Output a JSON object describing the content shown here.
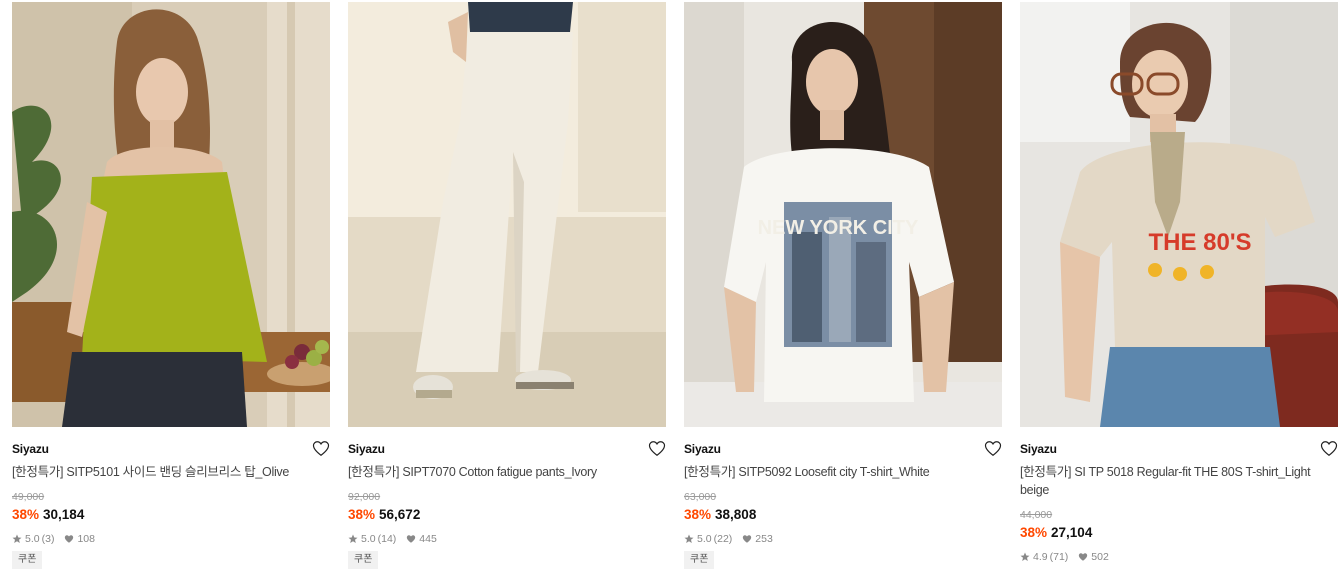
{
  "products": [
    {
      "brand": "Siyazu",
      "name": "[한정특가] SITP5101 사이드 밴딩 슬리브리스 탑_Olive",
      "original_price": "49,000",
      "discount": "38%",
      "price": "30,184",
      "rating": "5.0",
      "reviews": "(3)",
      "likes": "108",
      "badge": "쿠폰"
    },
    {
      "brand": "Siyazu",
      "name": "[한정특가] SIPT7070 Cotton fatigue pants_Ivory",
      "original_price": "92,000",
      "discount": "38%",
      "price": "56,672",
      "rating": "5.0",
      "reviews": "(14)",
      "likes": "445",
      "badge": "쿠폰"
    },
    {
      "brand": "Siyazu",
      "name": "[한정특가] SITP5092 Loosefit city T-shirt_White",
      "original_price": "63,000",
      "discount": "38%",
      "price": "38,808",
      "rating": "5.0",
      "reviews": "(22)",
      "likes": "253",
      "badge": "쿠폰"
    },
    {
      "brand": "Siyazu",
      "name": "[한정특가] SI TP 5018 Regular-fit THE 80S T-shirt_Light beige",
      "original_price": "44,000",
      "discount": "38%",
      "price": "27,104",
      "rating": "4.9",
      "reviews": "(71)",
      "likes": "502",
      "badge": ""
    }
  ],
  "print": {
    "tee1": "NEW YORK CITY",
    "tee2": "THE 80'S"
  },
  "colors": {
    "discount": "#ff4800",
    "olive": "#a3b21a"
  },
  "icons": [
    "heart-outline-icon",
    "star-icon",
    "heart-filled-icon"
  ]
}
